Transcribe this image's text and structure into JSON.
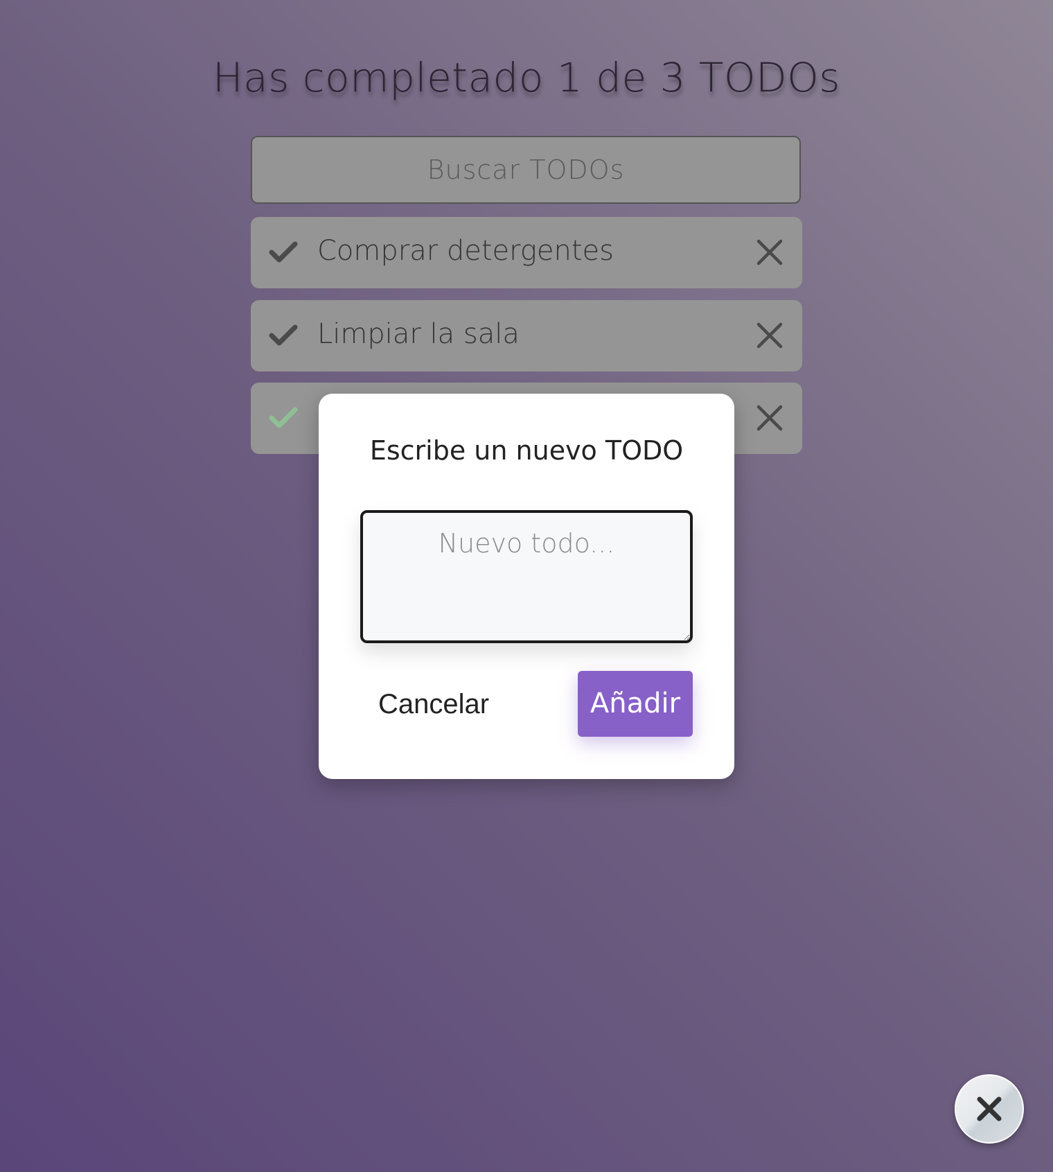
{
  "header": {
    "title": "Has completado 1 de 3 TODOs"
  },
  "search": {
    "placeholder": "Buscar TODOs"
  },
  "todos": [
    {
      "text": "Comprar detergentes",
      "completed": false
    },
    {
      "text": "Limpiar la sala",
      "completed": false
    },
    {
      "text": "",
      "completed": true
    }
  ],
  "icons": {
    "check": "check-icon",
    "delete": "close-icon",
    "fab": "close-icon"
  },
  "modal": {
    "title": "Escribe un nuevo TODO",
    "textarea_placeholder": "Nuevo todo...",
    "cancel_label": "Cancelar",
    "add_label": "Añadir"
  },
  "colors": {
    "accent": "#8760c8",
    "check_done": "#8fbf94",
    "check_pending": "#4a4a4a"
  }
}
